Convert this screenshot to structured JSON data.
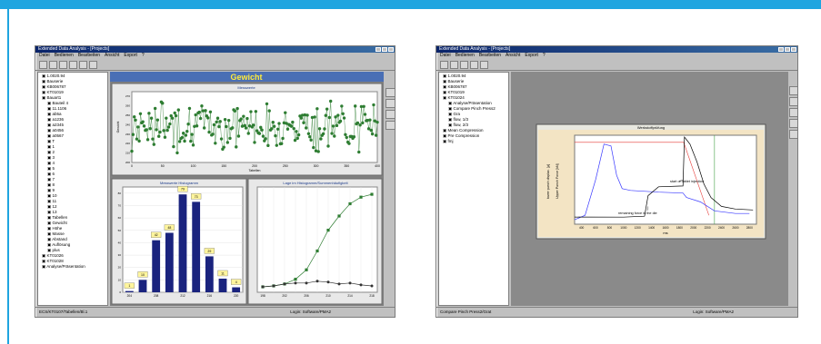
{
  "colors": {
    "frame": "#1fa5e0",
    "accent": "#0a246a",
    "series_green": "#2e7d32",
    "bar_navy": "#1a237e",
    "line_blue": "#3a3aff",
    "line_red": "#e53935"
  },
  "left": {
    "title": "Extended Data Analysis - [Projects]",
    "menu": [
      "Datei",
      "Bedienen",
      "Bearbeiten",
      "Ansicht",
      "Export",
      "?"
    ],
    "tree": [
      "1.0020.94",
      "Bauserie",
      "KB006787",
      "KT01019",
      "Bauart1",
      "Bauteil 4",
      "11.1106",
      "ab5a",
      "a1236",
      "a2345",
      "a0456",
      "a0567",
      "T",
      "1",
      "2",
      "3",
      "4",
      "5",
      "6",
      "7",
      "8",
      "9",
      "10",
      "11",
      "12",
      "13",
      "Tabellen",
      "Gewicht",
      "Höhe",
      "Masse",
      "Abstand",
      "Auflösung",
      "plus",
      "KT01026",
      "KT01028",
      "Analyse/Präsentation"
    ],
    "status_left": "ECS/KT0107/Tabellen/Bl.1",
    "status_right": "Login: Software/PMA2",
    "header": "Gewicht",
    "scatter_title": "Messwerte",
    "hist_title": "Messwerte Histogramm",
    "hist_labels": [
      1,
      10,
      42,
      48,
      79,
      73,
      29,
      11,
      4
    ],
    "line_title": "Lage im Histogramm/Summenhäufigkeit"
  },
  "right": {
    "title": "Extended Data Analysis - [Projects]",
    "menu": [
      "Datei",
      "Bedienen",
      "Bearbeiten",
      "Ansicht",
      "Export",
      "?"
    ],
    "tree": [
      "1.0020.94",
      "Bauserie",
      "KB006787",
      "KT01019",
      "KT01024",
      "Analyse/Präsentation",
      "Compare Pinch Press2",
      "Gra",
      "flow, 1/3",
      "flow, 2/3",
      "Mean Compression",
      "Pre Compression",
      "fmj"
    ],
    "status_left": "Compare Pinch Press2/Grat",
    "status_right": "Login: Software/PMA2",
    "chart_title": "Werkstoffprüfung",
    "annot1": "start of tablet injection",
    "annot2": "remaining force in the die",
    "xlabel": "ms",
    "ylabel_left": "tower punch displac. [µ]",
    "ylabel_right": "Upper Punch Force [kN]"
  },
  "chart_data": [
    {
      "type": "scatter",
      "title": "Messwerte",
      "xlabel": "Tabellen",
      "ylabel": "Gewicht",
      "ylim": [
        200,
        275
      ],
      "xlim": [
        0,
        400
      ],
      "x_ticks": [
        0,
        50,
        100,
        150,
        200,
        250,
        300,
        350,
        400
      ],
      "y_ticks": [
        200,
        205,
        210,
        215,
        220,
        225,
        230,
        235,
        240,
        245,
        250,
        255,
        260,
        265,
        270,
        275
      ],
      "note": "approximately 400 noisy points around 240"
    },
    {
      "type": "bar",
      "title": "Messwerte Histogramm",
      "categories": [
        "204",
        "206",
        "208",
        "210",
        "212",
        "214",
        "216",
        "218",
        "220"
      ],
      "values": [
        1,
        10,
        42,
        48,
        79,
        73,
        29,
        11,
        4
      ],
      "ylim": [
        0,
        85
      ]
    },
    {
      "type": "line",
      "title": "Lage im Histogramm/Summenhäufigkeit",
      "x": [
        198,
        200,
        202,
        204,
        206,
        208,
        210,
        212,
        214,
        216,
        218
      ],
      "series": [
        {
          "values": [
            0,
            1,
            3,
            8,
            18,
            38,
            60,
            75,
            88,
            95,
            98
          ]
        },
        {
          "values": [
            0,
            1,
            3,
            4,
            4,
            6,
            5,
            3,
            4,
            2,
            1
          ]
        }
      ]
    },
    {
      "type": "line",
      "title": "Werkstoffprüfung",
      "xlabel": "ms",
      "x_ticks": [
        400,
        600,
        800,
        1000,
        1200,
        1400,
        1600,
        1800,
        2000,
        2200,
        2400,
        2600,
        2800
      ]
    }
  ]
}
